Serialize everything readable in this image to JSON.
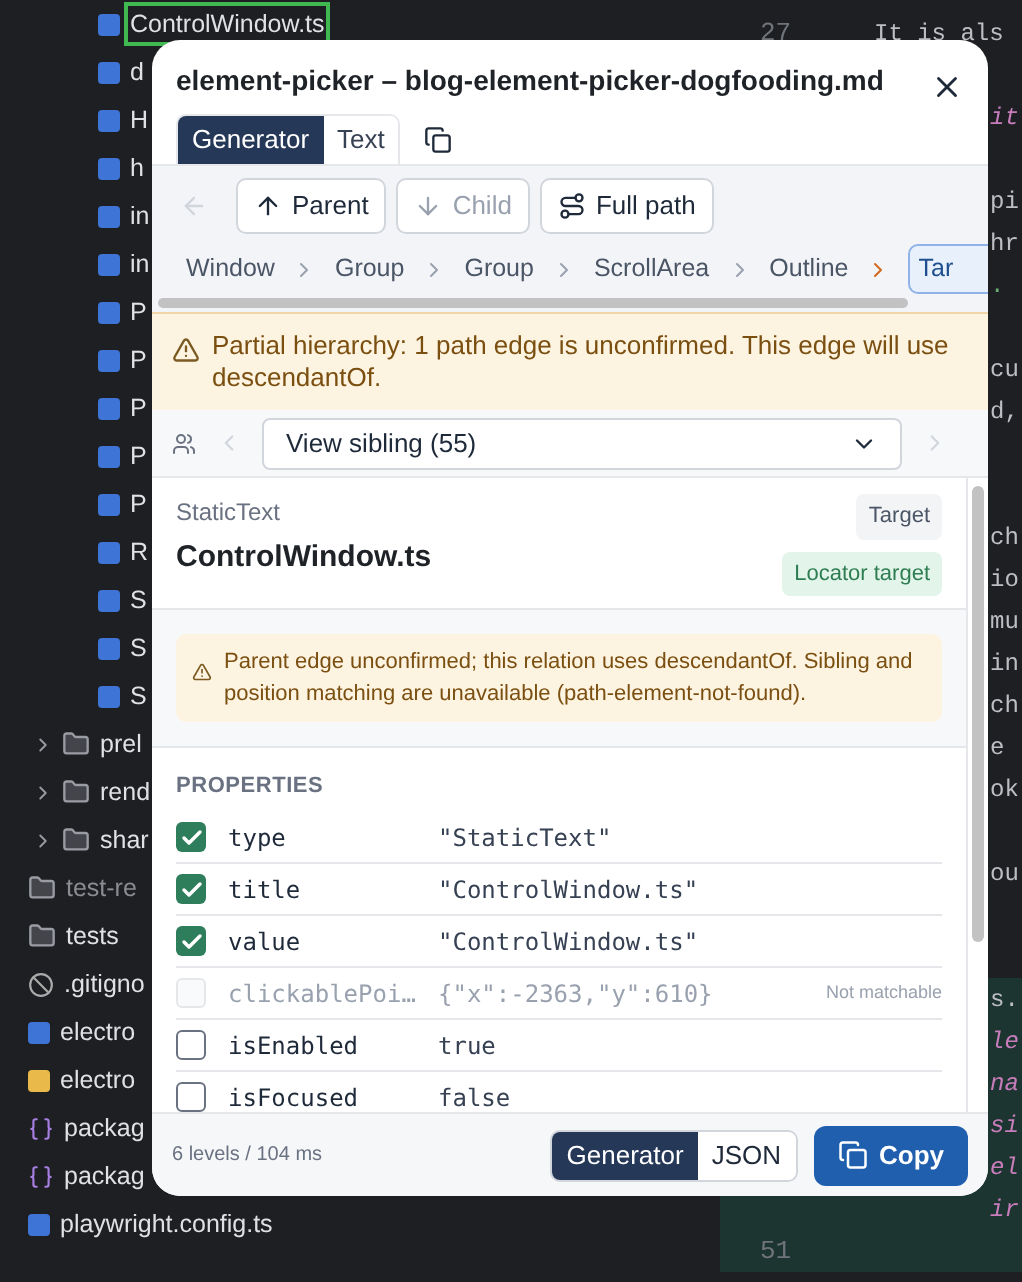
{
  "file_tree": [
    {
      "children": [
        {
          "children": [
            {
              "label": "ControlWindow.ts",
              "kind": "ts",
              "selected": true
            },
            {
              "label": "d",
              "kind": "ts",
              "selected": false
            },
            {
              "label": "H",
              "kind": "ts",
              "selected": false
            },
            {
              "label": "h",
              "kind": "ts",
              "selected": false
            },
            {
              "label": "in",
              "kind": "ts",
              "selected": false
            },
            {
              "label": "in",
              "kind": "ts",
              "selected": false
            },
            {
              "label": "P",
              "kind": "ts",
              "selected": false
            },
            {
              "label": "P",
              "kind": "ts",
              "selected": false
            },
            {
              "label": "P",
              "kind": "ts",
              "selected": false
            },
            {
              "label": "P",
              "kind": "ts",
              "selected": false
            },
            {
              "label": "P",
              "kind": "ts",
              "selected": false
            },
            {
              "label": "R",
              "kind": "ts",
              "selected": false
            },
            {
              "label": "S",
              "kind": "ts",
              "selected": false
            },
            {
              "label": "S",
              "kind": "ts",
              "selected": false
            },
            {
              "label": "S",
              "kind": "ts",
              "selected": false
            }
          ]
        },
        {
          "label": "prel",
          "kind": "folder",
          "expanded": false,
          "selected": false
        },
        {
          "label": "rend",
          "kind": "folder",
          "expanded": false,
          "selected": false
        },
        {
          "label": "shar",
          "kind": "folder",
          "expanded": false,
          "selected": false
        }
      ]
    },
    {
      "label": "test-re",
      "kind": "folder",
      "dimmed": true,
      "selected": false
    },
    {
      "label": "tests",
      "kind": "folder",
      "selected": false
    },
    {
      "label": ".gitigno",
      "kind": "ignore",
      "selected": false
    },
    {
      "label": "electro",
      "kind": "ts",
      "selected": false
    },
    {
      "label": "electro",
      "kind": "js",
      "selected": false
    },
    {
      "label": "packag",
      "kind": "json",
      "selected": false
    },
    {
      "label": "packag",
      "kind": "json",
      "selected": false
    },
    {
      "label": "playwright.config.ts",
      "kind": "ts",
      "selected": false
    }
  ],
  "editor": {
    "line_numbers": [
      "27",
      "51"
    ],
    "fragments": [
      {
        "text": "It is als",
        "kind": "plain"
      },
      {
        "text": "it",
        "kind": "keyword"
      },
      {
        "text": "pi",
        "kind": "plain"
      },
      {
        "text": "hr",
        "kind": "plain"
      },
      {
        "text": ".",
        "kind": "string"
      },
      {
        "text": "cu",
        "kind": "plain"
      },
      {
        "text": "d,",
        "kind": "plain"
      },
      {
        "text": "ch",
        "kind": "plain"
      },
      {
        "text": "io",
        "kind": "plain"
      },
      {
        "text": "mu",
        "kind": "plain"
      },
      {
        "text": "in",
        "kind": "plain"
      },
      {
        "text": "ch",
        "kind": "plain"
      },
      {
        "text": "e",
        "kind": "plain"
      },
      {
        "text": "ok",
        "kind": "plain"
      },
      {
        "text": "ou",
        "kind": "plain"
      },
      {
        "text": "s.",
        "kind": "plain"
      },
      {
        "text": "le",
        "kind": "keyword"
      },
      {
        "text": "na",
        "kind": "keyword"
      },
      {
        "text": "si",
        "kind": "keyword"
      },
      {
        "text": "el",
        "kind": "keyword"
      },
      {
        "text": "ir",
        "kind": "keyword"
      }
    ]
  },
  "dialog": {
    "title": "element-picker – blog-element-picker-dogfooding.md",
    "view_tabs": [
      {
        "label": "Generator",
        "selected": true
      },
      {
        "label": "Text",
        "selected": false
      }
    ],
    "back_button": {
      "disabled": true
    },
    "nav_buttons": [
      {
        "label": "Parent",
        "kind": "parent",
        "disabled": false
      },
      {
        "label": "Child",
        "kind": "child",
        "disabled": true
      },
      {
        "label": "Full path",
        "kind": "path",
        "disabled": false
      }
    ],
    "breadcrumbs": [
      {
        "label": "Window",
        "selected": false
      },
      {
        "label": "Group",
        "selected": false
      },
      {
        "label": "Group",
        "selected": false
      },
      {
        "label": "ScrollArea",
        "selected": false
      },
      {
        "label": "Outline",
        "selected": false
      },
      {
        "label": "Tar",
        "selected": true
      }
    ],
    "hierarchy_warning": "Partial hierarchy: 1 path edge is unconfirmed. This edge will use descendantOf.",
    "sibling": {
      "value": "View sibling (55)",
      "prev_disabled": true,
      "next_disabled": true
    },
    "element": {
      "role": "StaticText",
      "name": "ControlWindow.ts",
      "badges": [
        {
          "label": "Target",
          "kind": "neutral"
        },
        {
          "label": "Locator target",
          "kind": "success"
        }
      ]
    },
    "edge_warning": "Parent edge unconfirmed; this relation uses descendantOf. Sibling and position matching are unavailable (path-element-not-found).",
    "properties_heading": "PROPERTIES",
    "properties": [
      {
        "name": "type",
        "value": "\"StaticText\"",
        "checked": true,
        "disabled": false
      },
      {
        "name": "title",
        "value": "\"ControlWindow.ts\"",
        "checked": true,
        "disabled": false
      },
      {
        "name": "value",
        "value": "\"ControlWindow.ts\"",
        "checked": true,
        "disabled": false
      },
      {
        "name": "clickablePoi…",
        "value": "{\"x\":-2363,\"y\":610}",
        "checked": false,
        "disabled": true,
        "note": "Not matchable"
      },
      {
        "name": "isEnabled",
        "value": "true",
        "checked": false,
        "disabled": false
      },
      {
        "name": "isFocused",
        "value": "false",
        "checked": false,
        "disabled": false
      }
    ],
    "footer": {
      "stats": "6 levels / 104 ms",
      "format_tabs": [
        {
          "label": "Generator",
          "selected": true
        },
        {
          "label": "JSON",
          "selected": false
        }
      ],
      "copy_label": "Copy"
    }
  }
}
